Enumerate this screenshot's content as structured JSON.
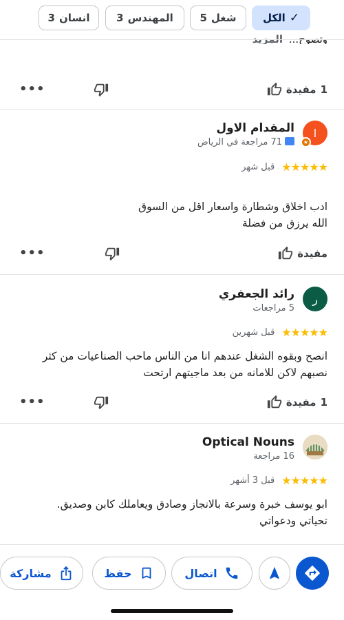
{
  "filters": {
    "all_label": "الكل",
    "work": {
      "count": "5",
      "label": "شغل"
    },
    "engineer": {
      "count": "3",
      "label": "المهندس"
    },
    "person": {
      "count": "3",
      "label": "انسان"
    }
  },
  "previous_review": {
    "text_tail": "وتصوح...",
    "more_label": "المزيد",
    "helpful_count": "1",
    "helpful_label": "مفيدة"
  },
  "reviews": [
    {
      "author": "المقدام الاول",
      "avatar_letter": "ا",
      "avatar_color": "#f4511e",
      "meta": "71 مراجعة في الرياض",
      "stars": "★★★★★",
      "time": "قبل شهر",
      "text_lines": [
        "ادب اخلاق وشطارة واسعار اقل من السوق",
        "الله يرزق من فضلة"
      ],
      "helpful_label": "مفيدة",
      "helpful_count": ""
    },
    {
      "author": "رائد الجعفري",
      "avatar_letter": "ر",
      "avatar_color": "#0b5c45",
      "meta": "5 مراجعات",
      "stars": "★★★★★",
      "time": "قبل شهرين",
      "text_lines": [
        "انصح وبقوه الشغل عندهم انا من الناس ماحب الصناعيات من كثر",
        "نصبهم لاكن للامانه من بعد ماجيتهم ارتحت"
      ],
      "helpful_label": "مفيدة",
      "helpful_count": "1"
    },
    {
      "author": "Optical Nouns",
      "avatar_letter": "",
      "avatar_color": "#c9a96b",
      "meta": "16 مراجعة",
      "stars": "★★★★★",
      "time": "قبل 3 أشهر",
      "text_lines": [
        "ابو يوسف خبرة وسرعة بالانجاز وصادق ويعاملك كابن وصديق.",
        "تحياتي ودعواتي"
      ]
    }
  ],
  "bottom_bar": {
    "call_label": "اتصال",
    "save_label": "حفظ",
    "share_label": "مشاركة"
  },
  "colors": {
    "accent": "#0b57d0",
    "star": "#fbbc04",
    "chip_selected": "#d3e3fd"
  },
  "icons": [
    "check-icon",
    "thumb-up-icon",
    "thumb-down-icon",
    "more-icon",
    "guide-badge-icon",
    "directions-icon",
    "navigation-icon",
    "phone-icon",
    "bookmark-icon",
    "share-icon"
  ]
}
